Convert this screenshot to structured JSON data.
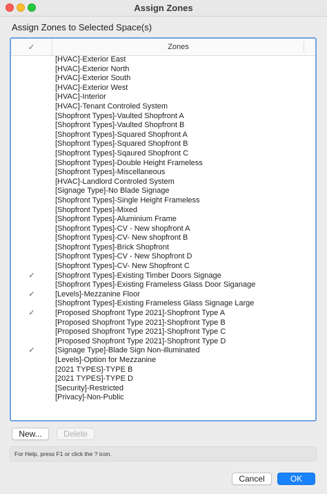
{
  "window": {
    "title": "Assign Zones"
  },
  "heading": "Assign Zones to Selected Space(s)",
  "table": {
    "check_header_icon": "checkmark-icon",
    "check_header_glyph": "✓",
    "zones_header": "Zones",
    "rows": [
      {
        "checked": false,
        "label": "[HVAC]-Exterior East"
      },
      {
        "checked": false,
        "label": "[HVAC]-Exterior North"
      },
      {
        "checked": false,
        "label": "[HVAC]-Exterior South"
      },
      {
        "checked": false,
        "label": "[HVAC]-Exterior West"
      },
      {
        "checked": false,
        "label": "[HVAC]-Interior"
      },
      {
        "checked": false,
        "label": "[HVAC]-Tenant Controled System"
      },
      {
        "checked": false,
        "label": "[Shopfront Types]-Vaulted Shopfront A"
      },
      {
        "checked": false,
        "label": "[Shopfront Types]-Vaulted Shopfront B"
      },
      {
        "checked": false,
        "label": "[Shopfront Types]-Squared Shopfront A"
      },
      {
        "checked": false,
        "label": "[Shopfront Types]-Squared Shopfront B"
      },
      {
        "checked": false,
        "label": "[Shopfront Types]-Sqaured Shopfront C"
      },
      {
        "checked": false,
        "label": "[Shopfront Types]-Double Height Frameless"
      },
      {
        "checked": false,
        "label": "[Shopfront Types]-Miscellaneous"
      },
      {
        "checked": false,
        "label": "[HVAC]-Landlord Controled System"
      },
      {
        "checked": false,
        "label": "[Signage Type]-No Blade Signage"
      },
      {
        "checked": false,
        "label": "[Shopfront Types]-Single Height Frameless"
      },
      {
        "checked": false,
        "label": "[Shopfront Types]-Mixed"
      },
      {
        "checked": false,
        "label": "[Shopfront Types]-Aluminium Frame"
      },
      {
        "checked": false,
        "label": "[Shopfront Types]-CV - New shopfront A"
      },
      {
        "checked": false,
        "label": "[Shopfront Types]-CV- New shopfront B"
      },
      {
        "checked": false,
        "label": "[Shopfront Types]-Brick Shopfront"
      },
      {
        "checked": false,
        "label": "[Shopfront Types]-CV - New Shopfront D"
      },
      {
        "checked": false,
        "label": "[Shopfront Types]-CV- New Shopfront C"
      },
      {
        "checked": true,
        "label": "[Shopfront Types]-Existing Timber Doors Signage"
      },
      {
        "checked": false,
        "label": "[Shopfront Types]-Existing Frameless Glass Door Siganage"
      },
      {
        "checked": true,
        "label": "[Levels]-Mezzanine Floor"
      },
      {
        "checked": false,
        "label": "[Shopfront Types]-Existing Frameless Glass Signage Large"
      },
      {
        "checked": true,
        "label": "[Proposed Shopfront Type 2021]-Shopfront Type A"
      },
      {
        "checked": false,
        "label": "[Proposed Shopfront Type 2021]-Shopfront Type B"
      },
      {
        "checked": false,
        "label": "[Proposed Shopfront Type 2021]-Shopfront Type C"
      },
      {
        "checked": false,
        "label": "[Proposed Shopfront Type 2021]-Shopfront Type D"
      },
      {
        "checked": true,
        "label": "[Signage Type]-Blade Sign Non-illuminated"
      },
      {
        "checked": false,
        "label": "[Levels]-Option for Mezzanine"
      },
      {
        "checked": false,
        "label": "[2021 TYPES]-TYPE B"
      },
      {
        "checked": false,
        "label": "[2021 TYPES]-TYPE D"
      },
      {
        "checked": false,
        "label": "[Security]-Restricted"
      },
      {
        "checked": false,
        "label": "[Privacy]-Non-Public"
      }
    ]
  },
  "buttons": {
    "new": "New...",
    "delete": "Delete",
    "cancel": "Cancel",
    "ok": "OK"
  },
  "help_text": "For Help, press F1 or click the ? icon.",
  "colors": {
    "accent": "#1a82fb",
    "focus_ring": "#6fa3e6"
  }
}
